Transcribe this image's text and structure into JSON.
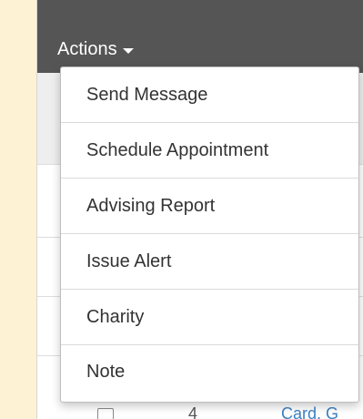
{
  "header": {
    "actions_label": "Actions"
  },
  "menu": {
    "items": [
      {
        "label": "Send Message"
      },
      {
        "label": "Schedule Appointment"
      },
      {
        "label": "Advising Report"
      },
      {
        "label": "Issue Alert"
      },
      {
        "label": "Charity"
      },
      {
        "label": "Note"
      }
    ]
  },
  "row": {
    "number": "4",
    "link_text": "Card, G"
  },
  "colors": {
    "page_bg": "#fdf2d4",
    "header_bg": "#555555",
    "link": "#3a82c4"
  }
}
